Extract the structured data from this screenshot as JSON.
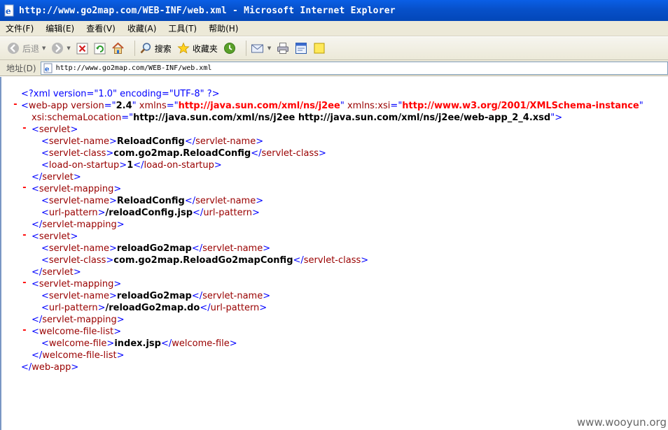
{
  "window": {
    "title": "http://www.go2map.com/WEB-INF/web.xml - Microsoft Internet Explorer"
  },
  "menu": {
    "items": [
      "文件(F)",
      "编辑(E)",
      "查看(V)",
      "收藏(A)",
      "工具(T)",
      "帮助(H)"
    ]
  },
  "toolbar": {
    "back_label": "后退",
    "search_label": "搜索",
    "favorites_label": "收藏夹"
  },
  "address": {
    "label": "地址(D)",
    "url": "http://www.go2map.com/WEB-INF/web.xml"
  },
  "xml": {
    "pi": "<?xml version=\"1.0\" encoding=\"UTF-8\" ?>",
    "webapp_version": "2.4",
    "xmlns": "http://java.sun.com/xml/ns/j2ee",
    "xmlns_xsi": "http://www.w3.org/2001/XMLSchema-instance",
    "schema_location": "http://java.sun.com/xml/ns/j2ee http://java.sun.com/xml/ns/j2ee/web-app_2_4.xsd",
    "servlet1_name": "ReloadConfig",
    "servlet1_class": "com.go2map.ReloadConfig",
    "servlet1_load": "1",
    "mapping1_name": "ReloadConfig",
    "mapping1_pattern": "/reloadConfig.jsp",
    "servlet2_name": "reloadGo2map",
    "servlet2_class": "com.go2map.ReloadGo2mapConfig",
    "mapping2_name": "reloadGo2map",
    "mapping2_pattern": "/reloadGo2map.do",
    "welcome_file": "index.jsp"
  },
  "watermark": "www.wooyun.org",
  "colors": {
    "titlebar": "#0a5fe6",
    "tag": "#990000",
    "punct": "#0000ff",
    "attr_value_url": "#ff0000"
  }
}
